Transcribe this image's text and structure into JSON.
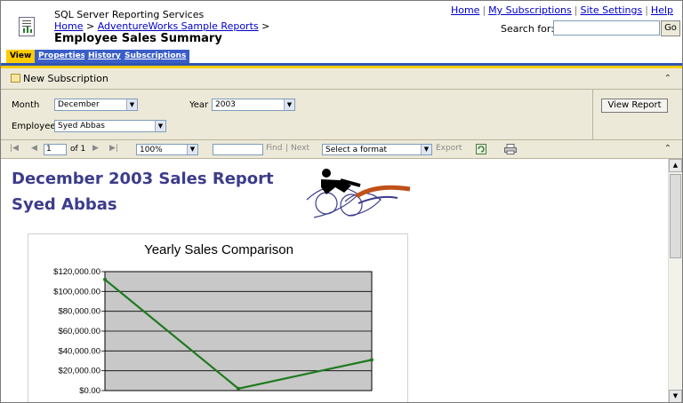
{
  "header": {
    "app_name": "SQL Server Reporting Services",
    "crumb_home": "Home",
    "crumb_sep": ">",
    "crumb_folder": "AdventureWorks Sample Reports",
    "page_title": "Employee Sales Summary",
    "links": {
      "home": "Home",
      "subscriptions": "My Subscriptions",
      "site_settings": "Site Settings",
      "help": "Help",
      "sep": "|"
    },
    "search_label": "Search for:",
    "search_value": "",
    "go_label": "Go"
  },
  "tabs": [
    {
      "label": "View",
      "active": true
    },
    {
      "label": "Properties",
      "active": false
    },
    {
      "label": "History",
      "active": false
    },
    {
      "label": "Subscriptions",
      "active": false
    }
  ],
  "subscription_bar": {
    "label": "New Subscription",
    "collapse_glyph": "⌃"
  },
  "params": {
    "month_label": "Month",
    "month_value": "December",
    "year_label": "Year",
    "year_value": "2003",
    "employee_label": "Employee",
    "employee_value": "Syed Abbas",
    "view_report_label": "View Report"
  },
  "toolbar": {
    "page_value": "1",
    "page_of": "of 1",
    "zoom_value": "100%",
    "find_label": "Find",
    "separator": "|",
    "next_label": "Next",
    "format_value": "Select a format",
    "export_label": "Export"
  },
  "report": {
    "title": "December 2003 Sales Report",
    "subtitle": "Syed Abbas"
  },
  "colors": {
    "tab_blue": "#3a5ec8",
    "tab_active": "#ffcc00",
    "report_title": "#3c3c8c",
    "line": "#1e7a1e",
    "plot_bg": "#c8c8c8"
  },
  "chart_data": {
    "type": "line",
    "title": "Yearly Sales Comparison",
    "xlabel": "",
    "ylabel": "",
    "ylim": [
      0,
      120000
    ],
    "y_ticks": [
      "$0.00",
      "$20,000.00",
      "$40,000.00",
      "$60,000.00",
      "$80,000.00",
      "$100,000.00",
      "$120,000.00"
    ],
    "y_tick_values": [
      0,
      20000,
      40000,
      60000,
      80000,
      100000,
      120000
    ],
    "series": [
      {
        "values": [
          112000,
          2000,
          31000
        ]
      }
    ],
    "grid": true
  }
}
